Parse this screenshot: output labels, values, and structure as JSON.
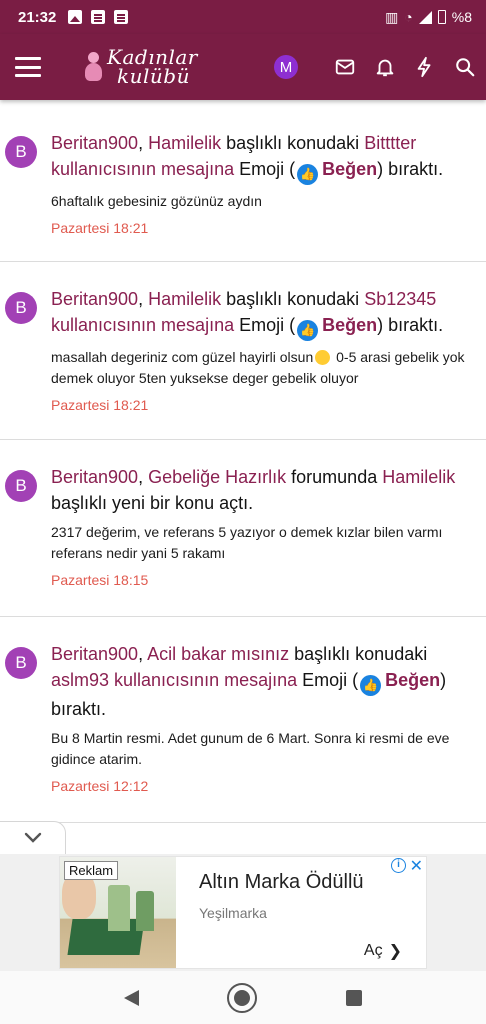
{
  "status_bar": {
    "time": "21:32",
    "battery": "%8"
  },
  "header": {
    "logo_line1": "Kadınlar",
    "logo_line2": "kulübü",
    "account_initial": "M"
  },
  "feed": [
    {
      "avatar": "B",
      "user": "Beritan900",
      "sep": ", ",
      "thread": "Hamilelik",
      "mid": " başlıklı konudaki ",
      "target": "Bitttter kullanıcısının mesajına",
      "action": " Emoji (",
      "reaction": "Beğen",
      "end": ") bıraktı.",
      "snippet": "6haftalık gebesiniz gözünüz aydın",
      "time": "Pazartesi 18:21"
    },
    {
      "avatar": "B",
      "user": "Beritan900",
      "sep": ", ",
      "thread": "Hamilelik",
      "mid": " başlıklı konudaki ",
      "target": "Sb12345 kullanıcısının mesajına",
      "action": " Emoji (",
      "reaction": "Beğen",
      "end": ") bıraktı.",
      "snippet_a": "masallah degeriniz com güzel hayirli olsun",
      "snippet_b": " 0-5 arasi gebelik yok demek oluyor 5ten yuksekse deger gebelik oluyor",
      "time": "Pazartesi 18:21"
    },
    {
      "avatar": "B",
      "user": "Beritan900",
      "sep": ", ",
      "forum": "Gebeliğe Hazırlık",
      "mid": " forumunda ",
      "thread": "Hamilelik",
      "end": " başlıklı yeni bir konu açtı.",
      "snippet": "2317 değerim, ve referans 5 yazıyor o demek kızlar bilen varmı referans nedir yani 5 rakamı",
      "time": "Pazartesi 18:15"
    },
    {
      "avatar": "B",
      "user": "Beritan900",
      "sep": ", ",
      "thread": "Acil bakar mısınız",
      "mid": " başlıklı konudaki ",
      "target": "aslm93 kullanıcısının mesajına",
      "action": " Emoji (",
      "reaction": "Beğen",
      "end": ") bıraktı.",
      "snippet": "Bu 8 Martin resmi. Adet gunum de 6 Mart. Sonra ki resmi de eve gidince atarim.",
      "time": "Pazartesi 12:12"
    }
  ],
  "ad": {
    "badge": "Reklam",
    "title": "Altın Marka Ödüllü",
    "advertiser": "Yeşilmarka",
    "cta": "Aç"
  },
  "colors": {
    "brand": "#7a1d44",
    "link": "#8a2151",
    "time": "#e05a4f",
    "like": "#1a83e0"
  }
}
